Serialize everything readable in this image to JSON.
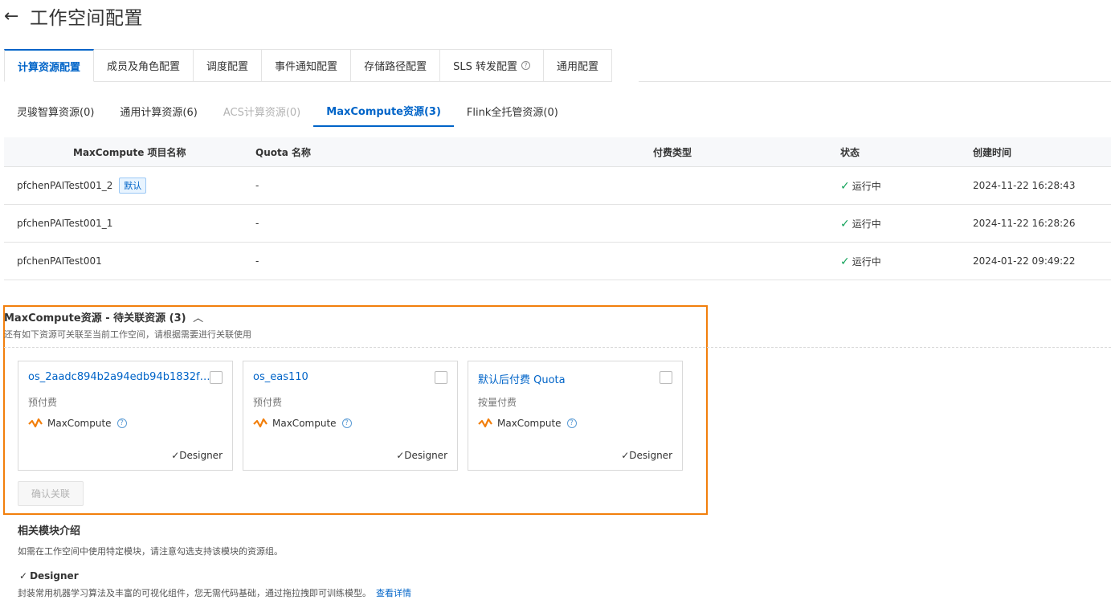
{
  "header": {
    "title": "工作空间配置"
  },
  "tabs": [
    {
      "label": "计算资源配置",
      "active": true
    },
    {
      "label": "成员及角色配置"
    },
    {
      "label": "调度配置"
    },
    {
      "label": "事件通知配置"
    },
    {
      "label": "存储路径配置"
    },
    {
      "label": "SLS 转发配置"
    },
    {
      "label": "通用配置"
    }
  ],
  "subtabs": [
    {
      "label": "灵骏智算资源(0)"
    },
    {
      "label": "通用计算资源(6)"
    },
    {
      "label": "ACS计算资源(0)",
      "disabled": true
    },
    {
      "label": "MaxCompute资源(3)",
      "active": true
    },
    {
      "label": "Flink全托管资源(0)"
    }
  ],
  "table": {
    "headers": [
      "MaxCompute 项目名称",
      "Quota 名称",
      "付费类型",
      "状态",
      "创建时间"
    ],
    "rows": [
      {
        "name": "pfchenPAITest001_2",
        "tag": "默认",
        "quota": "-",
        "billing": "",
        "status": "运行中",
        "created": "2024-11-22 16:28:43"
      },
      {
        "name": "pfchenPAITest001_1",
        "quota": "-",
        "billing": "",
        "status": "运行中",
        "created": "2024-11-22 16:28:26"
      },
      {
        "name": "pfchenPAITest001",
        "quota": "-",
        "billing": "",
        "status": "运行中",
        "created": "2024-01-22 09:49:22"
      }
    ]
  },
  "pending": {
    "title": "MaxCompute资源 - 待关联资源 (3)",
    "subtitle": "还有如下资源可关联至当前工作空间，请根据需要进行关联使用",
    "cards": [
      {
        "title": "os_2aadc894b2a94edb94b1832fb5...",
        "billing": "预付费",
        "service": "MaxCompute",
        "module": "Designer"
      },
      {
        "title": "os_eas110",
        "billing": "预付费",
        "service": "MaxCompute",
        "module": "Designer"
      },
      {
        "title": "默认后付费 Quota",
        "billing": "按量付费",
        "service": "MaxCompute",
        "module": "Designer"
      }
    ],
    "confirm_label": "确认关联"
  },
  "modules": {
    "title": "相关模块介绍",
    "desc": "如需在工作空间中使用特定模块，请注意勾选支持该模块的资源组。",
    "name": "Designer",
    "body": "封装常用机器学习算法及丰富的可视化组件，您无需代码基础，通过拖拉拽即可训练模型。",
    "link": "查看详情"
  },
  "colors": {
    "accent": "#0064c8",
    "highlight": "#f27f0c",
    "success": "#13a35a"
  }
}
